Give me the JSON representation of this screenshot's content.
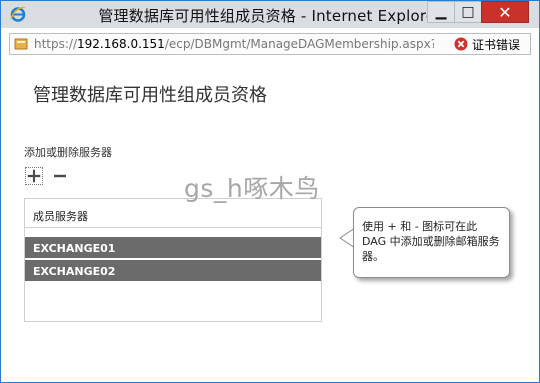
{
  "window": {
    "title": "管理数据库可用性组成员资格 - Internet Explorer",
    "minimize_glyph": "▁",
    "maximize_glyph": "□",
    "close_glyph": "✕"
  },
  "address_bar": {
    "scheme": "https://",
    "host": "192.168.0.151",
    "path": "/ecp/DBMgmt/ManageDAGMembership.aspx?pw",
    "cert_error_label": "证书错误"
  },
  "page": {
    "title": "管理数据库可用性组成员资格",
    "section_label": "添加或删除服务器",
    "list_header": "成员服务器",
    "members": [
      "EXCHANGE01",
      "EXCHANGE02"
    ],
    "callout_text": "使用 + 和 - 图标可在此 DAG 中添加或删除邮箱服务器。"
  },
  "watermark": "gs_h啄木鸟",
  "colors": {
    "titlebar": "#d9dde2",
    "close_button": "#c7322a",
    "selected_row": "#6b6b6b",
    "window_border": "#2a7bd0"
  },
  "icons": {
    "browser": "ie-logo-icon",
    "page": "page-icon",
    "cert": "cert-error-icon",
    "add": "add-icon",
    "remove": "remove-icon"
  }
}
